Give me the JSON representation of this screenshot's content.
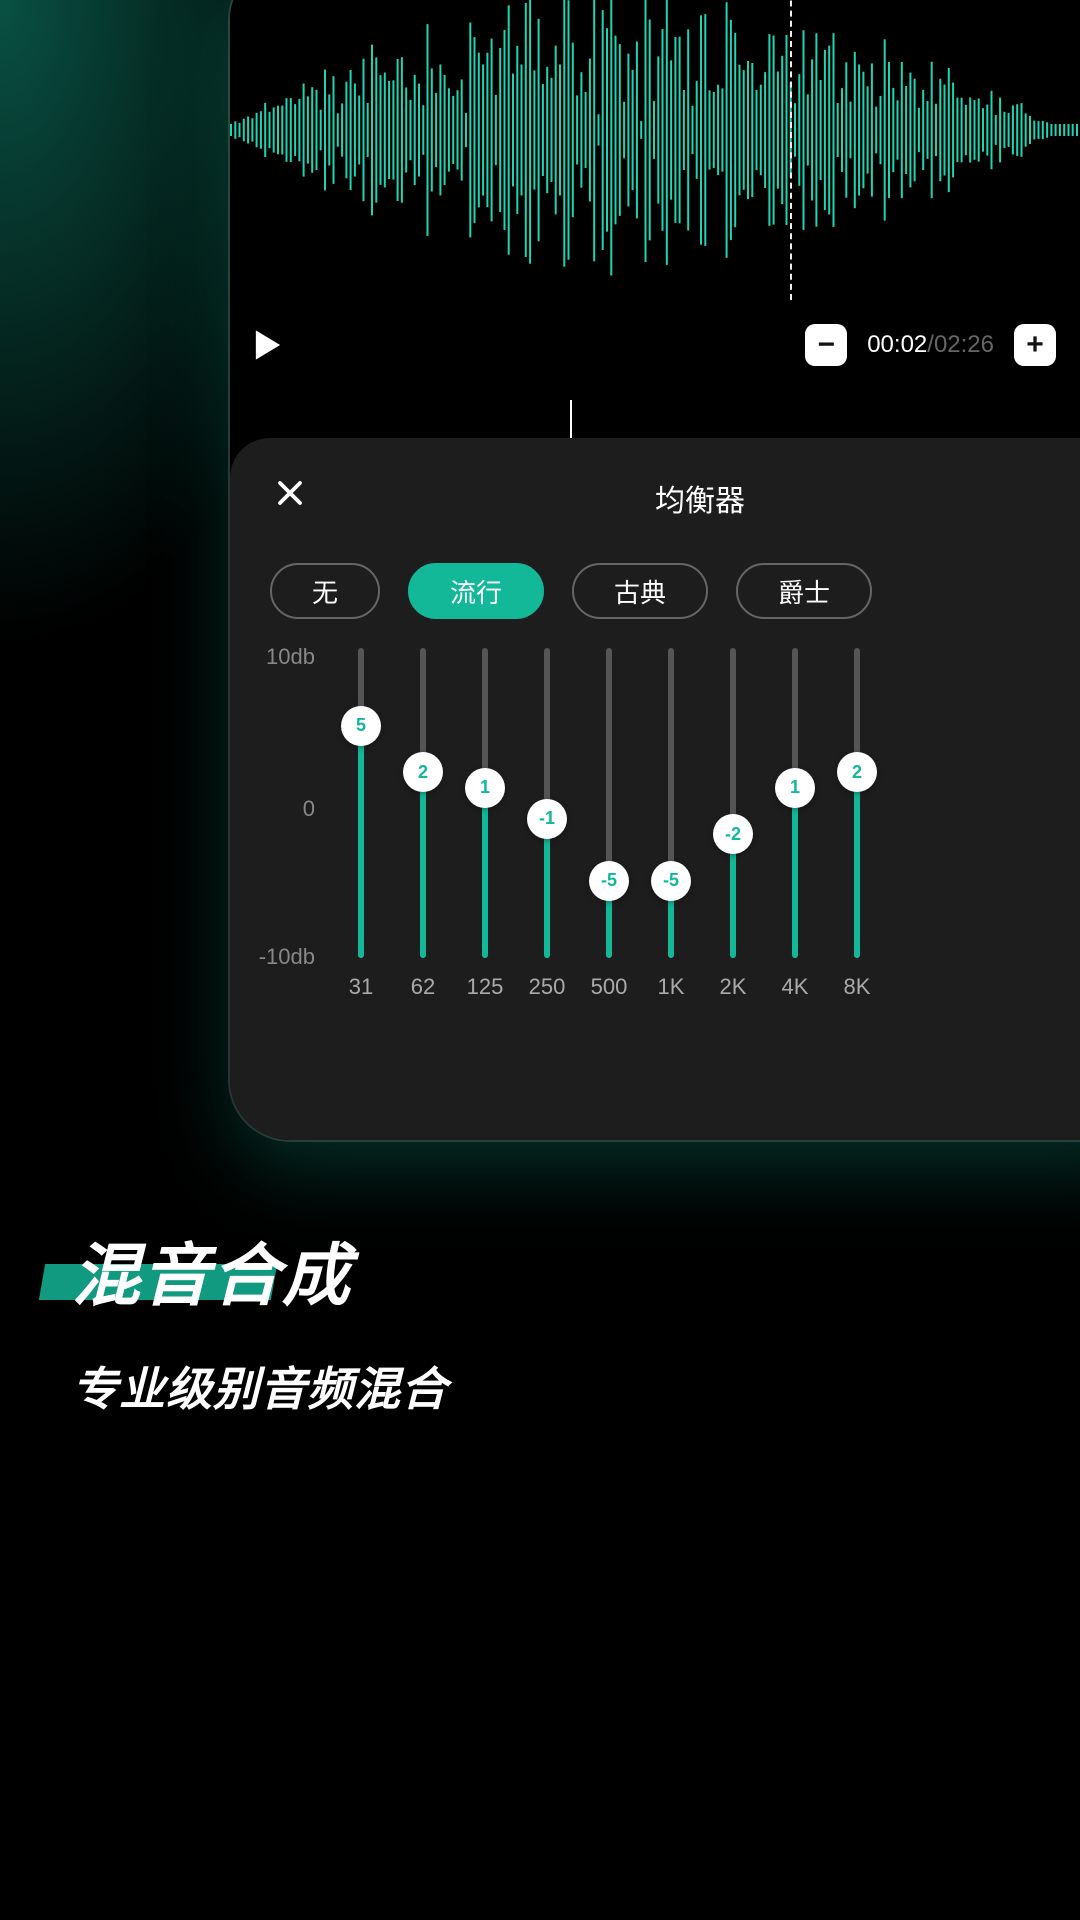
{
  "transport": {
    "current_time": "00:02",
    "sep": "/",
    "total_time": "02:26"
  },
  "sheet": {
    "title": "均衡器"
  },
  "presets": [
    {
      "label": "无",
      "active": false
    },
    {
      "label": "流行",
      "active": true
    },
    {
      "label": "古典",
      "active": false
    },
    {
      "label": "爵士",
      "active": false
    }
  ],
  "eq": {
    "y_top": "10db",
    "y_mid": "0",
    "y_bot": "-10db",
    "min": -10,
    "max": 10,
    "bands": [
      {
        "freq": "31",
        "value": 5
      },
      {
        "freq": "62",
        "value": 2
      },
      {
        "freq": "125",
        "value": 1
      },
      {
        "freq": "250",
        "value": -1
      },
      {
        "freq": "500",
        "value": -5
      },
      {
        "freq": "1K",
        "value": -5
      },
      {
        "freq": "2K",
        "value": -2
      },
      {
        "freq": "4K",
        "value": 1
      },
      {
        "freq": "8K",
        "value": 2
      }
    ]
  },
  "tagline": {
    "headline": "混音合成",
    "subline": "专业级别音频混合"
  }
}
